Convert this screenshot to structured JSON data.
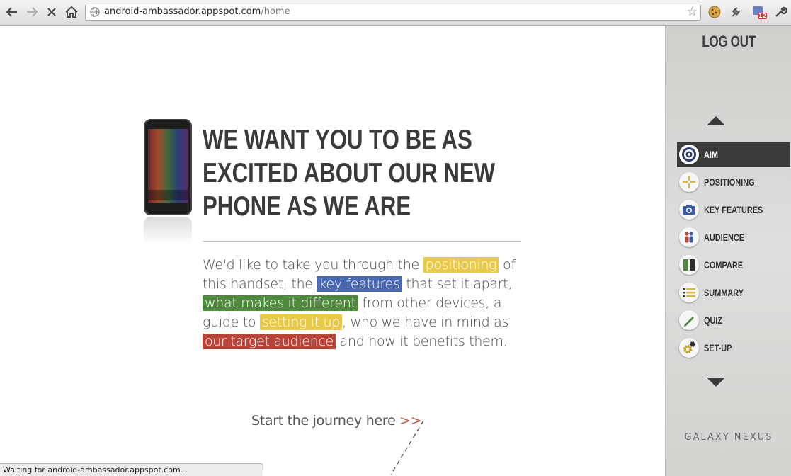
{
  "browser": {
    "url_host": "android-ambassador.appspot.com",
    "url_path": "/home",
    "status_text": "Waiting for android-ambassador.appspot.com...",
    "extension_badge": "12"
  },
  "sidebar": {
    "logout_label": "LOG OUT",
    "items": [
      {
        "label": "AIM",
        "icon": "target-icon",
        "active": true
      },
      {
        "label": "POSITIONING",
        "icon": "crosshair-icon",
        "active": false
      },
      {
        "label": "KEY FEATURES",
        "icon": "camera-icon",
        "active": false
      },
      {
        "label": "AUDIENCE",
        "icon": "people-icon",
        "active": false
      },
      {
        "label": "COMPARE",
        "icon": "compare-icon",
        "active": false
      },
      {
        "label": "SUMMARY",
        "icon": "list-icon",
        "active": false
      },
      {
        "label": "QUIZ",
        "icon": "pencil-icon",
        "active": false
      },
      {
        "label": "SET-UP",
        "icon": "gear-icon",
        "active": false
      }
    ],
    "brand": "GALAXY NEXUS"
  },
  "main": {
    "headline": [
      "WE WANT YOU TO BE AS",
      "EXCITED ABOUT OUR NEW",
      "PHONE AS WE ARE"
    ],
    "intro": {
      "t1": "We'd like to take you through the ",
      "h1": "positioning",
      "t2": " of this handset, the ",
      "h2": "key features",
      "t3": " that set it apart, ",
      "h3": "what makes it different",
      "t4": " from other devices, a guide to ",
      "h4": "setting it up",
      "t5": ", who we have in mind as ",
      "h5": "our target audience",
      "t6": " and how it benefits them."
    },
    "start_label": "Start the journey here",
    "start_arrows": ">>"
  },
  "colors": {
    "highlight_positioning": "#e8c94a",
    "highlight_key_features": "#4a68b0",
    "highlight_different": "#4f8a3c",
    "highlight_setup": "#e8c94a",
    "highlight_audience": "#b8443a"
  }
}
